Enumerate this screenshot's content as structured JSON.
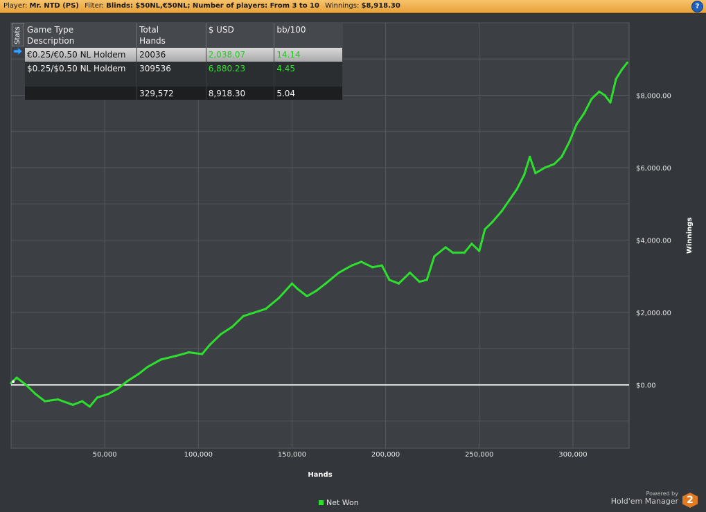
{
  "header": {
    "player_label": "Player:",
    "player_value": "Mr. NTD (PS)",
    "filter_label": "Filter:",
    "filter_value": "Blinds: $50NL,€50NL; Number of players: From 3 to 10",
    "winnings_label": "Winnings:",
    "winnings_value": "$8,918.30",
    "help_icon": "question-icon",
    "help_label": "?"
  },
  "stats_table": {
    "tab_label": "Stats",
    "columns": [
      "Game Type\nDescription",
      "Total\nHands",
      "$ USD",
      "bb/100"
    ],
    "rows": [
      {
        "game": "€0.25/€0.50 NL Holdem",
        "hands": "20036",
        "usd": "2,038.07",
        "bb100": "14.14",
        "selected": true
      },
      {
        "game": "$0.25/$0.50 NL Holdem",
        "hands": "309536",
        "usd": "6,880.23",
        "bb100": "4.45",
        "selected": false
      }
    ],
    "total": {
      "game": "",
      "hands": "329,572",
      "usd": "8,918.30",
      "bb100": "5.04"
    }
  },
  "chart_data": {
    "type": "line",
    "xlabel": "Hands",
    "ylabel": "Winnings",
    "xlim": [
      0,
      330000
    ],
    "ylim": [
      -1750,
      10000
    ],
    "x_ticks": [
      50000,
      100000,
      150000,
      200000,
      250000,
      300000
    ],
    "x_tick_labels": [
      "50,000",
      "100,000",
      "150,000",
      "200,000",
      "250,000",
      "300,000"
    ],
    "y_ticks": [
      0,
      2000,
      4000,
      6000,
      8000
    ],
    "y_tick_labels": [
      "$0.00",
      "$2,000.00",
      "$4,000.00",
      "$6,000.00",
      "$8,000.00"
    ],
    "grid": true,
    "legend_position": "bottom-center",
    "series": [
      {
        "name": "Net Won",
        "color": "#2ee02e",
        "x": [
          0,
          3000,
          8000,
          13000,
          18000,
          25000,
          33000,
          38000,
          42000,
          46000,
          52000,
          57000,
          62000,
          68000,
          73000,
          80000,
          88000,
          95000,
          102000,
          106000,
          112000,
          118000,
          124000,
          130000,
          136000,
          143000,
          150000,
          153000,
          158000,
          163000,
          168000,
          175000,
          182000,
          187000,
          193000,
          198000,
          202000,
          207000,
          213000,
          218000,
          222000,
          226000,
          232000,
          236000,
          242000,
          246000,
          250000,
          253000,
          257000,
          262000,
          266000,
          270000,
          274000,
          277000,
          280000,
          285000,
          290000,
          294000,
          298000,
          302000,
          306000,
          310000,
          314000,
          317000,
          320000,
          323000,
          326000,
          329000
        ],
        "y": [
          50,
          200,
          0,
          -250,
          -450,
          -400,
          -550,
          -450,
          -600,
          -350,
          -250,
          -100,
          100,
          300,
          500,
          700,
          800,
          900,
          850,
          1100,
          1400,
          1600,
          1900,
          2000,
          2100,
          2400,
          2800,
          2650,
          2450,
          2600,
          2800,
          3100,
          3300,
          3400,
          3250,
          3300,
          2900,
          2800,
          3100,
          2850,
          2900,
          3550,
          3800,
          3650,
          3650,
          3900,
          3700,
          4300,
          4500,
          4800,
          5100,
          5400,
          5800,
          6300,
          5850,
          6000,
          6100,
          6300,
          6700,
          7200,
          7500,
          7900,
          8100,
          8000,
          7800,
          8450,
          8700,
          8900
        ]
      }
    ]
  },
  "legend": {
    "label": "Net Won"
  },
  "brand": {
    "powered_by": "Powered by",
    "name": "Hold'em Manager",
    "badge": "2"
  }
}
